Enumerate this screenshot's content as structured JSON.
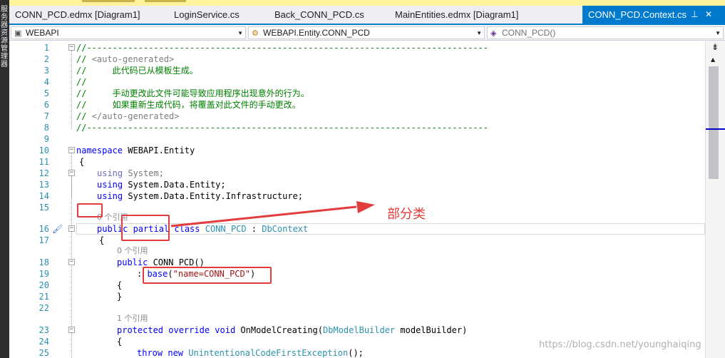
{
  "left_strip": {
    "label": "服务器资源管理器"
  },
  "tabs": [
    {
      "label": "CONN_PCD.edmx [Diagram1]",
      "active": false
    },
    {
      "label": "LoginService.cs",
      "active": false
    },
    {
      "label": "Back_CONN_PCD.cs",
      "active": false
    },
    {
      "label": "MainEntities.edmx [Diagram1]",
      "active": false
    },
    {
      "label": "CONN_PCD.Context.cs",
      "active": true
    }
  ],
  "tab_controls": {
    "pin": "⊥",
    "close": "✕"
  },
  "navbar": {
    "project": "WEBAPI",
    "class": "WEBAPI.Entity.CONN_PCD",
    "member": "CONN_PCD()"
  },
  "line_numbers": [
    "1",
    "2",
    "3",
    "4",
    "5",
    "6",
    "7",
    "8",
    "9",
    "10",
    "11",
    "12",
    "13",
    "14",
    "15",
    "16",
    "17",
    "18",
    "19",
    "20",
    "21",
    "22",
    "23",
    "24",
    "25"
  ],
  "code": {
    "l1": "//------------------------------------------------------------------------------",
    "l2_open": "// ",
    "l2_tag": "<auto-generated>",
    "l3": "//     此代码已从模板生成。",
    "l4": "//",
    "l5": "//     手动更改此文件可能导致应用程序出现意外的行为。",
    "l6": "//     如果重新生成代码，将覆盖对此文件的手动更改。",
    "l7_open": "// ",
    "l7_tag": "</auto-generated>",
    "l8": "//------------------------------------------------------------------------------",
    "l10_kw": "namespace",
    "l10_name": " WEBAPI.Entity",
    "l11": "{",
    "l12_kw": "using",
    "l12_rest": " System;",
    "l13_kw": "using",
    "l13_rest": " System.Data.Entity;",
    "l14_kw": "using",
    "l14_rest": " System.Data.Entity.Infrastructure;",
    "ref0_a": "0 个引用",
    "l16_public": "public",
    "l16_partial": " partial",
    "l16_class": " class",
    "l16_name": " CONN_PCD",
    "l16_colon": " : ",
    "l16_base": "DbContext",
    "l17": "{",
    "ref0_b": "0 个引用",
    "l18_public": "public",
    "l18_rest": " CONN_PCD()",
    "l19_colon": ": ",
    "l19_base": "base",
    "l19_open": "(",
    "l19_str": "\"name=CONN_PCD\"",
    "l19_close": ")",
    "l20": "{",
    "l21": "}",
    "ref1": "1 个引用",
    "l23_protected": "protected",
    "l23_override": " override",
    "l23_void": " void",
    "l23_method": " OnModelCreating(",
    "l23_type": "DbModelBuilder",
    "l23_param": " modelBuilder)",
    "l24": "{",
    "l25_throw": "throw",
    "l25_new": " new",
    "l25_type": " UnintentionalCodeFirstException",
    "l25_rest": "();"
  },
  "annotation": {
    "label": "部分类",
    "color": "#e23c3c"
  },
  "scrollbar": {
    "split_button": "⇟"
  },
  "watermark": "https://blog.csdn.net/younghaiqing",
  "colors": {
    "accent": "#007acc",
    "keyword": "#0000ff",
    "type": "#2b91af",
    "comment": "#008000",
    "string": "#a31515"
  }
}
